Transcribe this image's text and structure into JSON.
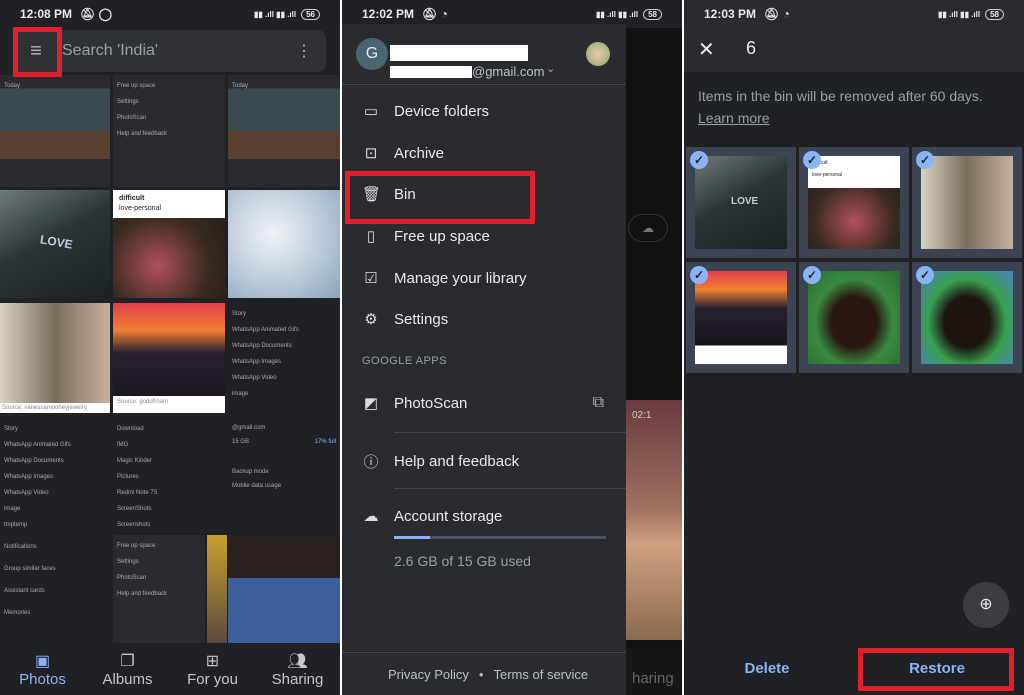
{
  "left": {
    "status": {
      "time": "12:08 PM",
      "battery": "56"
    },
    "search": {
      "placeholder": "Search 'India'"
    },
    "thumbs": {
      "today": "Today",
      "post_user": "difficult",
      "post_board": "love-personal",
      "source1": "Source: vanessamooneyjewelry",
      "source2": "Source: godofroam",
      "list_a": [
        "Story",
        "WhatsApp Animated Gifs",
        "WhatsApp Documents",
        "WhatsApp Images",
        "WhatsApp Video",
        "image",
        "tmptemp"
      ],
      "list_b": [
        "Download",
        "IMG",
        "Magic Kinder",
        "Pictures",
        "Redmi Note 7S",
        "ScreenShots",
        "Screenshots"
      ],
      "list_c": [
        "Notifications",
        "Group similar faces",
        "Assistant cards",
        "Memories"
      ],
      "account_email": "@gmail.com",
      "storage_total": "15 GB",
      "storage_pct": "17% full",
      "backup_mode": "Backup mode",
      "mobile_data": "Mobile data usage",
      "drawer_items": [
        "Free up space",
        "Settings",
        "PhotoScan",
        "Help and feedback"
      ]
    },
    "nav": [
      {
        "label": "Photos",
        "icon": "photo-icon",
        "active": true
      },
      {
        "label": "Albums",
        "icon": "albums-icon"
      },
      {
        "label": "For you",
        "icon": "for-you-icon"
      },
      {
        "label": "Sharing",
        "icon": "sharing-icon"
      }
    ]
  },
  "middle": {
    "status": {
      "time": "12:02 PM",
      "battery": "58"
    },
    "account": {
      "initial": "G",
      "email_suffix": "@gmail.com"
    },
    "menu": [
      {
        "label": "Device folders",
        "icon": "folder-icon"
      },
      {
        "label": "Archive",
        "icon": "archive-icon"
      },
      {
        "label": "Bin",
        "icon": "trash-icon"
      },
      {
        "label": "Free up space",
        "icon": "free-up-space-icon"
      },
      {
        "label": "Manage your library",
        "icon": "manage-library-icon"
      },
      {
        "label": "Settings",
        "icon": "gear-icon"
      }
    ],
    "section_label": "GOOGLE APPS",
    "photoscan": "PhotoScan",
    "help": "Help and feedback",
    "storage": {
      "label": "Account storage",
      "used_text": "2.6 GB of 15 GB used",
      "used_fraction": 0.17
    },
    "footer": {
      "privacy": "Privacy Policy",
      "dot": "•",
      "terms": "Terms of service"
    },
    "behind": {
      "timestamp": "02:1",
      "nav_partial": "haring"
    }
  },
  "right": {
    "status": {
      "time": "12:03 PM",
      "battery": "58"
    },
    "selected_count": "6",
    "notice": "Items in the bin will be removed after 60 days.",
    "learn_more": "Learn more",
    "items": [
      "LOVE street",
      "difficult / love-personal roses",
      "clothing rack",
      "sunset window",
      "birthday cake",
      "birthday cake 2"
    ],
    "delete": "Delete",
    "restore": "Restore",
    "accent": "#8ab4f8",
    "highlight": "#e0202a"
  }
}
